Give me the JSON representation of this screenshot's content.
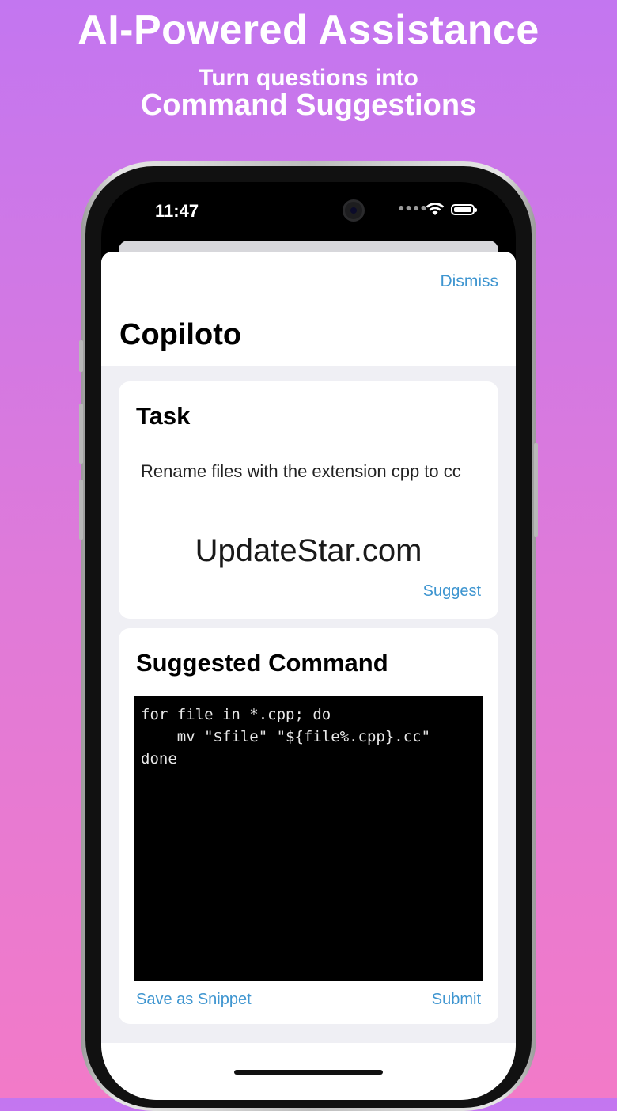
{
  "promo": {
    "headline": "AI-Powered Assistance",
    "subheadline_line1": "Turn questions into",
    "subheadline_line2": "Command Suggestions"
  },
  "status_bar": {
    "time": "11:47",
    "signal_icon": "signal-dots-icon",
    "wifi_icon": "wifi-icon",
    "battery_icon": "battery-icon"
  },
  "sheet": {
    "dismiss_label": "Dismiss",
    "title": "Copiloto"
  },
  "task_card": {
    "title": "Task",
    "text": "Rename files with the extension cpp to cc",
    "watermark": "UpdateStar.com",
    "suggest_label": "Suggest"
  },
  "suggested_card": {
    "title": "Suggested Command",
    "command_lines": [
      "for file in *.cpp; do",
      "    mv \"$file\" \"${file%.cpp}.cc\"",
      "done"
    ],
    "save_label": "Save as Snippet",
    "submit_label": "Submit"
  },
  "colors": {
    "accent": "#3e95d0",
    "background_top": "#c376f0",
    "background_bottom": "#f27ac8"
  }
}
